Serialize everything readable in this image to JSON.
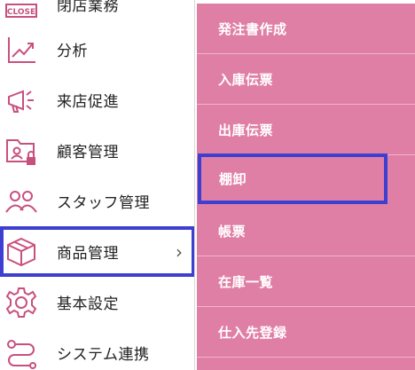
{
  "sidebar": {
    "items": [
      {
        "label": "閉店業務",
        "icon_text": "CLOSE"
      },
      {
        "label": "分析"
      },
      {
        "label": "来店促進"
      },
      {
        "label": "顧客管理"
      },
      {
        "label": "スタッフ管理"
      },
      {
        "label": "商品管理",
        "chevron": "›"
      },
      {
        "label": "基本設定"
      },
      {
        "label": "システム連携"
      }
    ]
  },
  "submenu": {
    "items": [
      {
        "label": "発注書作成"
      },
      {
        "label": "入庫伝票"
      },
      {
        "label": "出庫伝票"
      },
      {
        "label": "棚卸"
      },
      {
        "label": "帳票"
      },
      {
        "label": "在庫一覧"
      },
      {
        "label": "仕入先登録"
      }
    ]
  },
  "colors": {
    "accent_pink": "#e07fa5",
    "icon_pink": "#c8507f",
    "selection_blue": "#3d3fd0"
  }
}
